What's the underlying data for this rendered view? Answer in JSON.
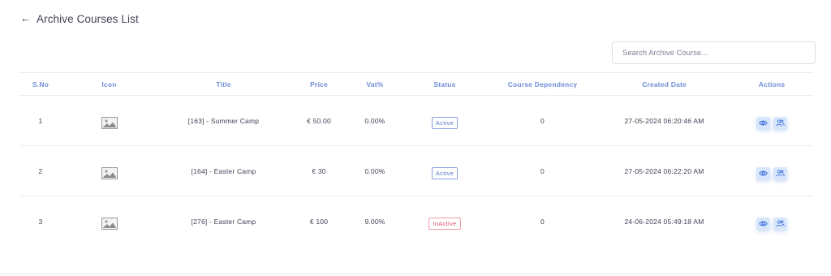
{
  "header": {
    "back_icon": "←",
    "title": "Archive Courses List"
  },
  "search": {
    "placeholder": "Search Archive Course..."
  },
  "table": {
    "columns": [
      "S.No",
      "Icon",
      "Title",
      "Price",
      "Vat%",
      "Status",
      "Course Dependency",
      "Created Date",
      "Actions"
    ],
    "rows": [
      {
        "sno": "1",
        "icon": "image-placeholder-icon",
        "title": "[163] - Summer Camp",
        "price": "€ 50.00",
        "vat": "0.00%",
        "status": "Active",
        "dependency": "0",
        "created": "27-05-2024 06:20:46 AM"
      },
      {
        "sno": "2",
        "icon": "image-placeholder-icon",
        "title": "[164] - Easter Camp",
        "price": "€ 30",
        "vat": "0.00%",
        "status": "Active",
        "dependency": "0",
        "created": "27-05-2024 06:22:20 AM"
      },
      {
        "sno": "3",
        "icon": "image-placeholder-icon",
        "title": "[276] - Easter Camp",
        "price": "€ 100",
        "vat": "9.00%",
        "status": "InActive",
        "dependency": "0",
        "created": "24-06-2024 05:49:18 AM"
      }
    ]
  },
  "colors": {
    "header_text": "#6f8fd6",
    "active_badge": "#5e7cc9",
    "inactive_badge": "#e0566b",
    "action_bg": "#d7e6fb",
    "action_icon": "#3d6fd9"
  },
  "icons": {
    "view": "eye-icon",
    "users": "users-icon"
  }
}
